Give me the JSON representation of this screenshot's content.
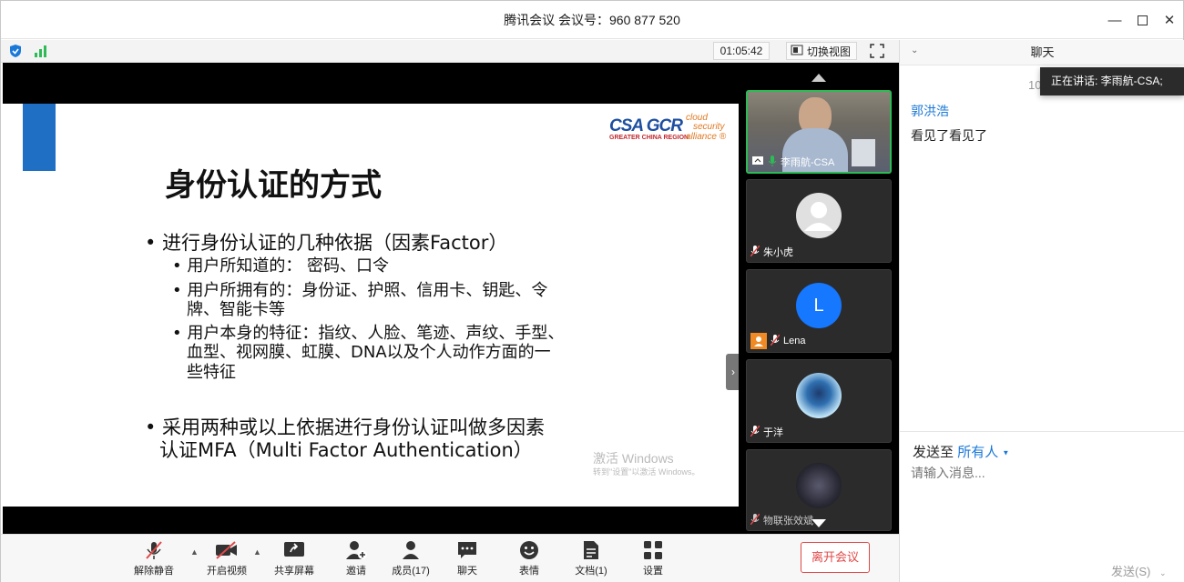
{
  "window": {
    "title": "腾讯会议 会议号：960 877 520"
  },
  "topbar": {
    "timer": "01:05:42",
    "switch_view": "切换视图"
  },
  "slide": {
    "title": "身份认证的方式",
    "bullets": [
      "• 进行身份认证的几种依据（因素Factor）",
      "• 用户所知道的： 密码、口令",
      "• 用户所拥有的：身份证、护照、信用卡、钥匙、令",
      "牌、智能卡等",
      "• 用户本身的特征：指纹、人脸、笔迹、声纹、手型、",
      "血型、视网膜、虹膜、DNA以及个人动作方面的一",
      "些特征",
      "• 采用两种或以上依据进行身份认证叫做多因素",
      "认证MFA（Multi Factor Authentication）"
    ],
    "logo": {
      "brand": "CSA GCR",
      "line1": "GREATER CHINA REGION",
      "cloud": "cloud",
      "security": "security",
      "alliance": "alliance ®"
    },
    "watermark": {
      "line1": "激活 Windows",
      "line2": "转到\"设置\"以激活 Windows。"
    }
  },
  "participants": [
    {
      "name": "李雨航-CSA",
      "avatar": "video",
      "color": "#6b6b6b"
    },
    {
      "name": "朱小虎",
      "avatar": "gray",
      "color": "#d8d8d8"
    },
    {
      "name": "Lena",
      "avatar": "L",
      "color": "#1677ff"
    },
    {
      "name": "于洋",
      "avatar": "anime",
      "color": "#5aa0d8"
    },
    {
      "name": "物联张效斌",
      "avatar": "dark",
      "color": "#3a3a4a"
    }
  ],
  "toolbar": {
    "mute": "解除静音",
    "video": "开启视频",
    "share": "共享屏幕",
    "invite": "邀请",
    "members": "成员(17)",
    "chat": "聊天",
    "emoji": "表情",
    "docs": "文档(1)",
    "settings": "设置",
    "leave": "离开会议"
  },
  "chat": {
    "title": "聊天",
    "speaking": "正在讲话: 李雨航-CSA;",
    "time": "10",
    "sender": "郭洪浩",
    "message": "看见了看见了",
    "send_to_label": "发送至",
    "send_to_target": "所有人",
    "input_placeholder": "请输入消息...",
    "send_button": "发送(S)"
  },
  "colors": {
    "accent": "#1a78d8",
    "active_border": "#2dbb55",
    "leave": "#e04848",
    "slide_blue": "#1f6fc5"
  }
}
